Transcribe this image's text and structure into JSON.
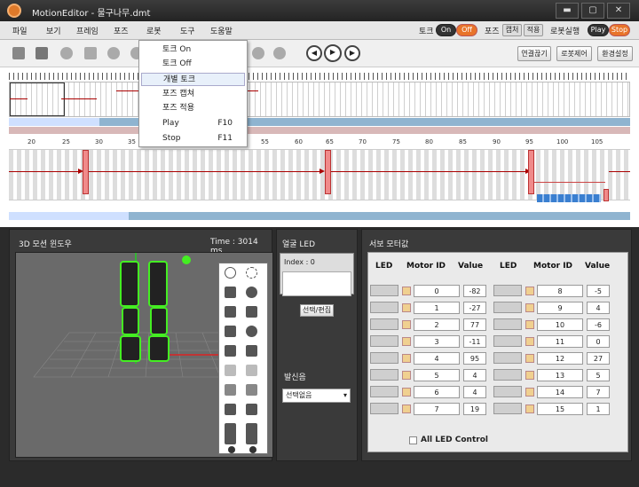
{
  "window": {
    "title": "MotionEditor - 물구나무.dmt",
    "min": "▬",
    "max": "▢",
    "close": "✕"
  },
  "menu": [
    "파일",
    "보기",
    "프레임",
    "포즈",
    "로봇",
    "도구",
    "도움말"
  ],
  "status_bar": {
    "torque_label": "토크",
    "on": "On",
    "off": "Off",
    "pose_label": "포즈",
    "capture": "캡처",
    "apply": "적용",
    "robot_run": "로봇실행",
    "play": "Play",
    "stop": "Stop"
  },
  "toolbar": {
    "connect": "연결끊기",
    "robot_ctrl": "로봇제어",
    "settings": "환경설정"
  },
  "dropdown": {
    "items": [
      {
        "label": "토크 On",
        "shortcut": ""
      },
      {
        "label": "토크 Off",
        "shortcut": ""
      },
      {
        "label": "개별 토크",
        "shortcut": ""
      },
      {
        "label": "포즈 캡쳐",
        "shortcut": ""
      },
      {
        "label": "포즈 적용",
        "shortcut": ""
      },
      {
        "label": "Play",
        "shortcut": "F10"
      },
      {
        "label": "Stop",
        "shortcut": "F11"
      }
    ]
  },
  "ruler": [
    "20",
    "25",
    "30",
    "35",
    "40",
    "45",
    "50",
    "55",
    "60",
    "65",
    "70",
    "75",
    "80",
    "85",
    "90",
    "95",
    "100",
    "105"
  ],
  "view3d": {
    "title": "3D 모션 윈도우",
    "time": "Time : 3014 ms"
  },
  "eye_led": {
    "title": "얼굴 LED",
    "index": "Index : 0",
    "edit_button": "선택/편집",
    "sound_title": "발신음",
    "sound_value": "선택없음"
  },
  "servo": {
    "title": "서보 모터값",
    "headers": {
      "led": "LED",
      "motor_id": "Motor ID",
      "value": "Value"
    },
    "left": [
      {
        "id": "0",
        "value": "-82"
      },
      {
        "id": "1",
        "value": "-27"
      },
      {
        "id": "2",
        "value": "77"
      },
      {
        "id": "3",
        "value": "-11"
      },
      {
        "id": "4",
        "value": "95"
      },
      {
        "id": "5",
        "value": "4"
      },
      {
        "id": "6",
        "value": "4"
      },
      {
        "id": "7",
        "value": "19"
      }
    ],
    "right": [
      {
        "id": "8",
        "value": "-5"
      },
      {
        "id": "9",
        "value": "4"
      },
      {
        "id": "10",
        "value": "-6"
      },
      {
        "id": "11",
        "value": "0"
      },
      {
        "id": "12",
        "value": "27"
      },
      {
        "id": "13",
        "value": "5"
      },
      {
        "id": "14",
        "value": "7"
      },
      {
        "id": "15",
        "value": "1"
      }
    ],
    "all_led": "All LED Control"
  },
  "colors": {
    "accent_orange": "#e8742a",
    "keyframe": "#f08a8a",
    "robot_green": "#44ee22"
  }
}
